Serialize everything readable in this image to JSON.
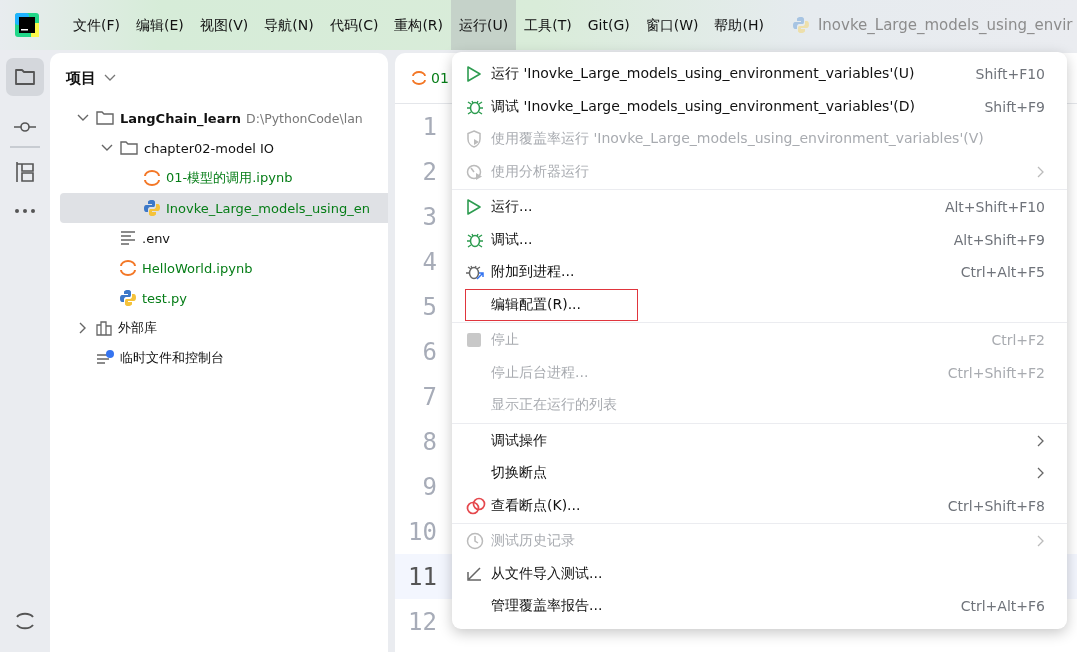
{
  "menubar": {
    "items": [
      {
        "label": "文件(F)",
        "selected": false
      },
      {
        "label": "编辑(E)",
        "selected": false
      },
      {
        "label": "视图(V)",
        "selected": false
      },
      {
        "label": "导航(N)",
        "selected": false
      },
      {
        "label": "代码(C)",
        "selected": false
      },
      {
        "label": "重构(R)",
        "selected": false
      },
      {
        "label": "运行(U)",
        "selected": true
      },
      {
        "label": "工具(T)",
        "selected": false
      },
      {
        "label": "Git(G)",
        "selected": false
      },
      {
        "label": "窗口(W)",
        "selected": false
      },
      {
        "label": "帮助(H)",
        "selected": false
      }
    ],
    "run_config": "Inovke_Large_models_using_envir"
  },
  "project": {
    "title": "项目",
    "tree": [
      {
        "label": "LangChain_learn",
        "path": "D:\\PythonCode\\lan",
        "kind": "folder",
        "expanded": true,
        "selected": false,
        "children": [
          {
            "label": "chapter02-model IO",
            "kind": "folder",
            "expanded": true,
            "selected": false,
            "children": [
              {
                "label": "01-模型的调用.ipynb",
                "kind": "notebook",
                "selected": false
              },
              {
                "label": "Inovke_Large_models_using_en",
                "kind": "python",
                "selected": true
              }
            ]
          },
          {
            "label": ".env",
            "kind": "text",
            "selected": false
          },
          {
            "label": "HelloWorld.ipynb",
            "kind": "notebook",
            "selected": false
          },
          {
            "label": "test.py",
            "kind": "python",
            "selected": false
          }
        ]
      },
      {
        "label": "外部库",
        "kind": "library",
        "expanded": false,
        "selected": false
      },
      {
        "label": "临时文件和控制台",
        "kind": "scratch",
        "selected": false
      }
    ]
  },
  "editor": {
    "tab": "01",
    "lines": [
      {
        "number": "1",
        "current": false
      },
      {
        "number": "2",
        "current": false
      },
      {
        "number": "3",
        "current": false
      },
      {
        "number": "4",
        "current": false
      },
      {
        "number": "5",
        "current": false
      },
      {
        "number": "6",
        "current": false
      },
      {
        "number": "7",
        "current": false
      },
      {
        "number": "8",
        "current": false
      },
      {
        "number": "9",
        "current": false
      },
      {
        "number": "10",
        "current": false
      },
      {
        "number": "11",
        "current": true
      },
      {
        "number": "12",
        "current": false
      }
    ]
  },
  "run_menu": [
    {
      "kind": "run",
      "label": "运行 'Inovke_Large_models_using_environment_variables'(U)",
      "shortcut": "Shift+F10",
      "disabled": false,
      "submenu": false,
      "marked": false
    },
    {
      "kind": "debug",
      "label": "调试 'Inovke_Large_models_using_environment_variables'(D)",
      "shortcut": "Shift+F9",
      "disabled": false,
      "submenu": false,
      "marked": false
    },
    {
      "kind": "coverage",
      "label": "使用覆盖率运行 'Inovke_Large_models_using_environment_variables'(V)",
      "disabled": true,
      "submenu": false,
      "marked": false
    },
    {
      "kind": "profiler",
      "label": "使用分析器运行",
      "disabled": true,
      "submenu": true,
      "marked": false
    },
    {
      "kind": "separator"
    },
    {
      "kind": "run",
      "label": "运行...",
      "shortcut": "Alt+Shift+F10",
      "disabled": false,
      "submenu": false,
      "marked": false
    },
    {
      "kind": "debug",
      "label": "调试...",
      "shortcut": "Alt+Shift+F9",
      "disabled": false,
      "submenu": false,
      "marked": false
    },
    {
      "kind": "attach",
      "label": "附加到进程...",
      "shortcut": "Ctrl+Alt+F5",
      "disabled": false,
      "submenu": false,
      "marked": false
    },
    {
      "kind": "plain",
      "label": "编辑配置(R)...",
      "disabled": false,
      "submenu": false,
      "marked": true
    },
    {
      "kind": "separator"
    },
    {
      "kind": "stop",
      "label": "停止",
      "shortcut": "Ctrl+F2",
      "disabled": true,
      "submenu": false,
      "marked": false
    },
    {
      "kind": "plain",
      "label": "停止后台进程...",
      "shortcut": "Ctrl+Shift+F2",
      "disabled": true,
      "submenu": false,
      "marked": false
    },
    {
      "kind": "plain",
      "label": "显示正在运行的列表",
      "disabled": true,
      "submenu": false,
      "marked": false
    },
    {
      "kind": "separator"
    },
    {
      "kind": "plain",
      "label": "调试操作",
      "disabled": false,
      "submenu": true,
      "marked": false
    },
    {
      "kind": "plain",
      "label": "切换断点",
      "disabled": false,
      "submenu": true,
      "marked": false
    },
    {
      "kind": "breakpoints",
      "label": "查看断点(K)...",
      "shortcut": "Ctrl+Shift+F8",
      "disabled": false,
      "submenu": false,
      "marked": false
    },
    {
      "kind": "separator"
    },
    {
      "kind": "history",
      "label": "测试历史记录",
      "disabled": true,
      "submenu": true,
      "marked": false
    },
    {
      "kind": "import",
      "label": "从文件导入测试...",
      "disabled": false,
      "submenu": false,
      "marked": false
    },
    {
      "kind": "plain",
      "label": "管理覆盖率报告...",
      "shortcut": "Ctrl+Alt+F6",
      "disabled": false,
      "submenu": false,
      "marked": false
    }
  ]
}
